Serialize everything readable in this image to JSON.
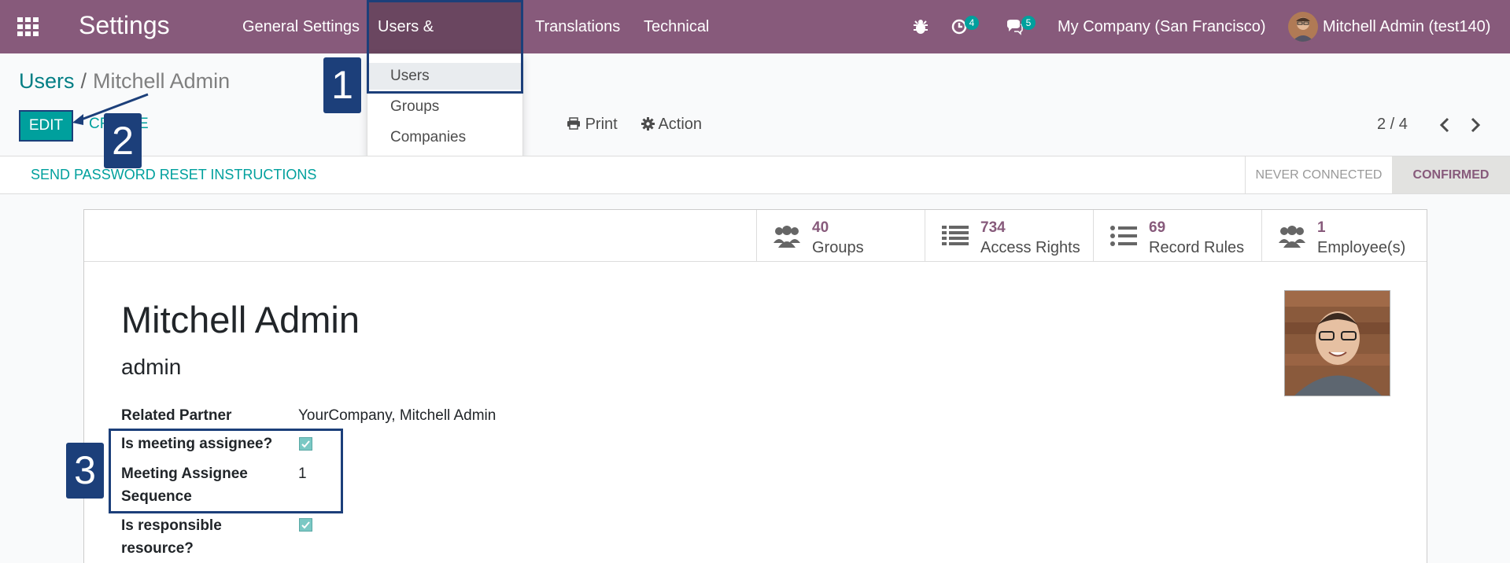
{
  "topbar": {
    "app_title": "Settings",
    "menu": [
      "General Settings",
      "Users & Companies",
      "Translations",
      "Technical"
    ],
    "activities_count": "4",
    "messages_count": "5",
    "company": "My Company (San Francisco)",
    "user": "Mitchell Admin (test140)"
  },
  "dropdown": {
    "items": [
      "Users",
      "Groups",
      "Companies"
    ]
  },
  "breadcrumb": {
    "parent": "Users",
    "separator": "/",
    "current": "Mitchell Admin"
  },
  "toolbar": {
    "edit": "EDIT",
    "create": "CREATE",
    "print": "Print",
    "action": "Action",
    "pager": "2 / 4"
  },
  "statusbar": {
    "reset": "SEND PASSWORD RESET INSTRUCTIONS",
    "stages": [
      "NEVER CONNECTED",
      "CONFIRMED"
    ],
    "active_stage": "CONFIRMED"
  },
  "smart_buttons": [
    {
      "value": "40",
      "label": "Groups",
      "icon": "users-icon"
    },
    {
      "value": "734",
      "label": "Access Rights",
      "icon": "list-icon"
    },
    {
      "value": "69",
      "label": "Record Rules",
      "icon": "list-ul-icon"
    },
    {
      "value": "1",
      "label": "Employee(s)",
      "icon": "users-icon"
    }
  ],
  "record": {
    "name": "Mitchell Admin",
    "login": "admin",
    "fields": {
      "related_partner_label": "Related Partner",
      "related_partner_value": "YourCompany, Mitchell Admin",
      "meeting_assignee_label": "Is meeting assignee?",
      "meeting_assignee_checked": true,
      "sequence_label": "Meeting Assignee Sequence",
      "sequence_value": "1",
      "responsible_label": "Is responsible resource?",
      "responsible_checked": true
    }
  },
  "annotations": [
    "1",
    "2",
    "3"
  ],
  "colors": {
    "primary": "#875a7b",
    "accent": "#00a09d",
    "annotation": "#1c3f7a"
  }
}
